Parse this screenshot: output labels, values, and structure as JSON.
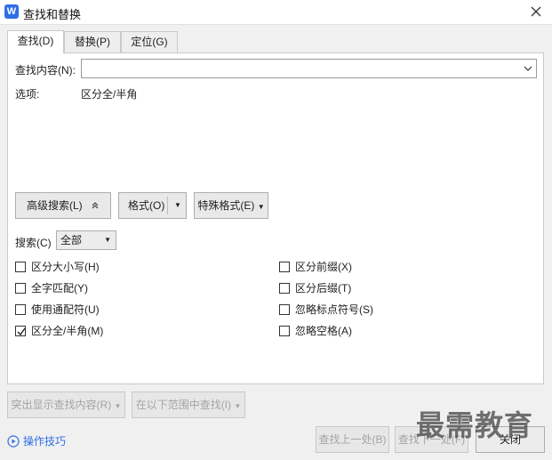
{
  "window": {
    "title": "查找和替换",
    "logo_text": "W"
  },
  "tabs": [
    {
      "label": "查找(D)",
      "active": true
    },
    {
      "label": "替换(P)",
      "active": false
    },
    {
      "label": "定位(G)",
      "active": false
    }
  ],
  "find": {
    "label": "查找内容(N):",
    "value": "",
    "placeholder": ""
  },
  "options": {
    "label": "选项:",
    "value": "区分全/半角"
  },
  "buttons": {
    "advanced": "高级搜索(L)",
    "format": "格式(O)",
    "special": "特殊格式(E)"
  },
  "search": {
    "label": "搜索(C)",
    "selected": "全部"
  },
  "checkboxes_left": [
    {
      "label": "区分大小写(H)",
      "checked": false
    },
    {
      "label": "全字匹配(Y)",
      "checked": false
    },
    {
      "label": "使用通配符(U)",
      "checked": false
    },
    {
      "label": "区分全/半角(M)",
      "checked": true
    }
  ],
  "checkboxes_right": [
    {
      "label": "区分前缀(X)",
      "checked": false
    },
    {
      "label": "区分后缀(T)",
      "checked": false
    },
    {
      "label": "忽略标点符号(S)",
      "checked": false
    },
    {
      "label": "忽略空格(A)",
      "checked": false
    }
  ],
  "footer": {
    "highlight": "突出显示查找内容(R)",
    "find_in": "在以下范围中查找(I)",
    "find_prev": "查找上一处(B)",
    "find_next": "查找下一处(F)",
    "close": "关闭",
    "tips": "操作技巧"
  },
  "watermark": "最需教育",
  "colors": {
    "accent": "#2f6fe6",
    "disabled_text": "#a4a4a4"
  }
}
